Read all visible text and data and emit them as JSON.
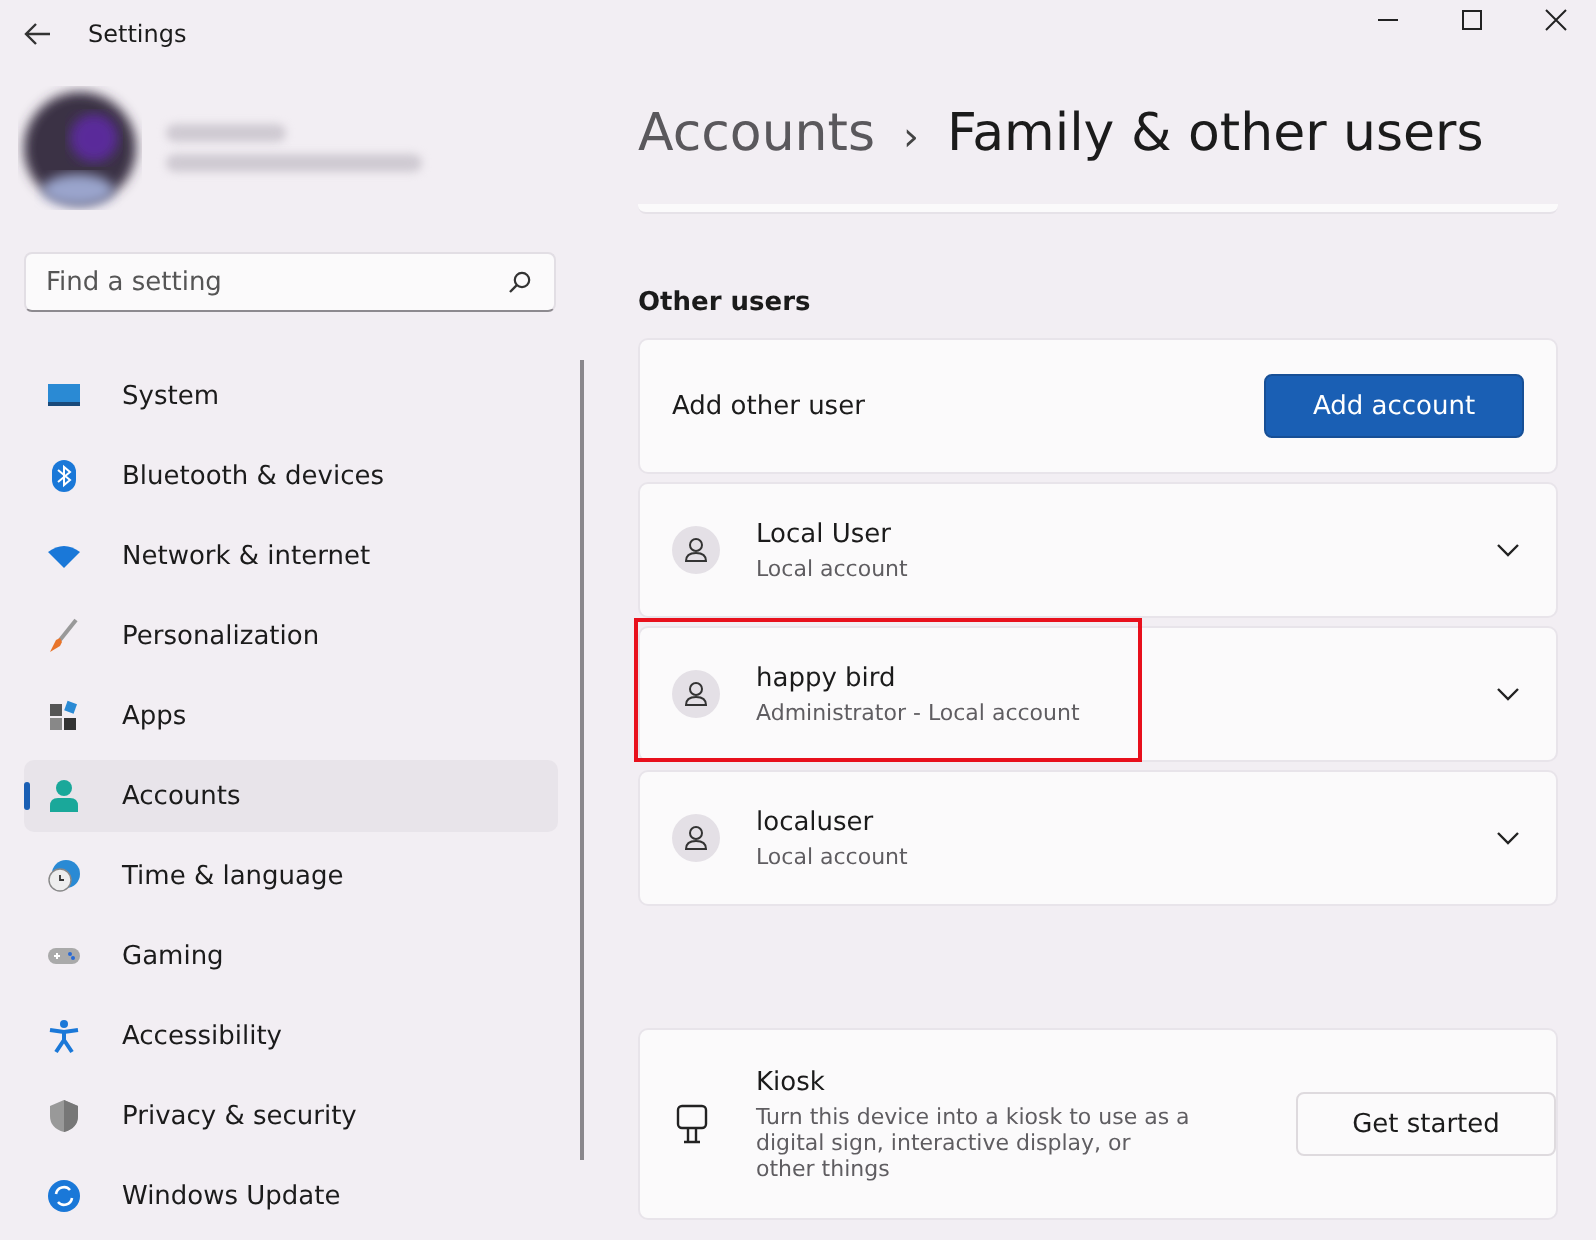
{
  "window": {
    "title": "Settings"
  },
  "search": {
    "placeholder": "Find a setting"
  },
  "sidebar": {
    "items": [
      {
        "label": "System",
        "selected": false
      },
      {
        "label": "Bluetooth & devices",
        "selected": false
      },
      {
        "label": "Network & internet",
        "selected": false
      },
      {
        "label": "Personalization",
        "selected": false
      },
      {
        "label": "Apps",
        "selected": false
      },
      {
        "label": "Accounts",
        "selected": true
      },
      {
        "label": "Time & language",
        "selected": false
      },
      {
        "label": "Gaming",
        "selected": false
      },
      {
        "label": "Accessibility",
        "selected": false
      },
      {
        "label": "Privacy & security",
        "selected": false
      },
      {
        "label": "Windows Update",
        "selected": false
      }
    ]
  },
  "breadcrumb": {
    "parent": "Accounts",
    "separator": "›",
    "current": "Family & other users"
  },
  "other_users": {
    "heading": "Other users",
    "add_label": "Add other user",
    "add_button": "Add account",
    "users": [
      {
        "name": "Local User",
        "type": "Local account",
        "highlighted": false
      },
      {
        "name": "happy bird",
        "type": "Administrator - Local account",
        "highlighted": true
      },
      {
        "name": "localuser",
        "type": "Local account",
        "highlighted": false
      }
    ]
  },
  "kiosk": {
    "title": "Kiosk",
    "description": "Turn this device into a kiosk to use as a digital sign, interactive display, or other things",
    "button": "Get started"
  }
}
